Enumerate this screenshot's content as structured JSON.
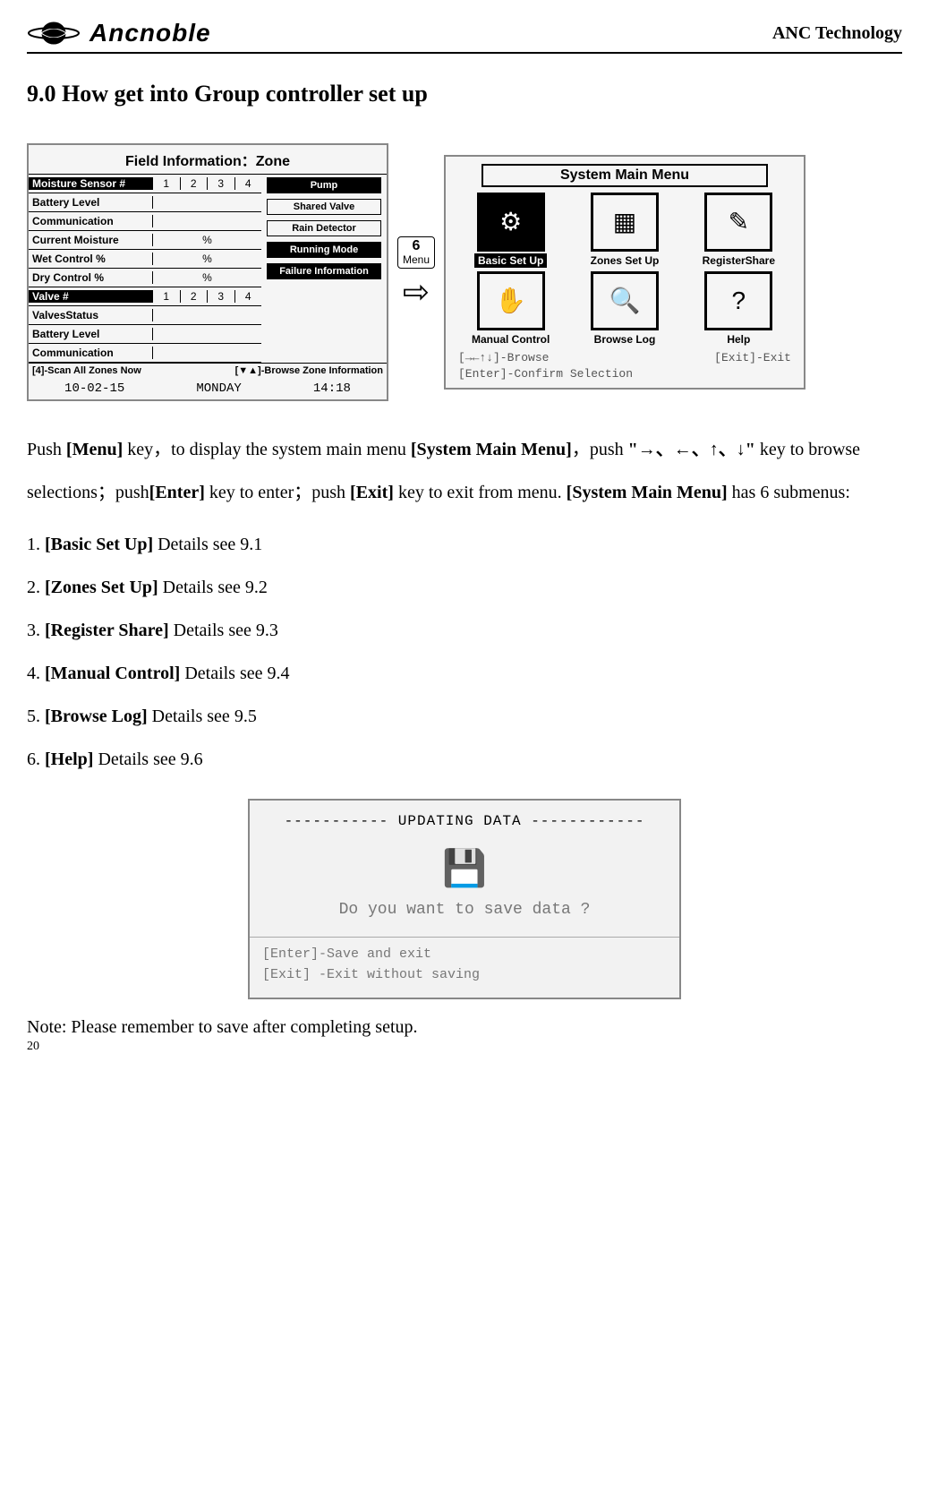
{
  "header": {
    "logo_text": "Ancnoble",
    "right_text": "ANC Technology"
  },
  "section_title": "9.0 How get into Group controller set up",
  "screen1": {
    "title": "Field Information：Zone",
    "rows_left": [
      {
        "label": "Moisture Sensor #",
        "cells": [
          "1",
          "2",
          "3",
          "4"
        ],
        "inv": true
      },
      {
        "label": "Battery Level"
      },
      {
        "label": "Communication"
      },
      {
        "label": "Current Moisture",
        "pct": "%"
      },
      {
        "label": "Wet Control %",
        "pct": "%"
      },
      {
        "label": "Dry Control %",
        "pct": "%"
      },
      {
        "label": "Valve  #",
        "cells": [
          "1",
          "2",
          "3",
          "4"
        ],
        "inv": true
      },
      {
        "label": "ValvesStatus"
      },
      {
        "label": "Battery Level"
      },
      {
        "label": "Communication"
      }
    ],
    "right_buttons": [
      {
        "t": "Pump",
        "inv": true
      },
      {
        "t": "Shared Valve",
        "inv": false
      },
      {
        "t": "Rain Detector",
        "inv": false
      },
      {
        "t": "Running Mode",
        "inv": true
      },
      {
        "t": "Failure Information",
        "inv": true
      }
    ],
    "foot_left": "[4]-Scan All Zones Now",
    "foot_right": "[▼▲]-Browse Zone Information",
    "status_date": "10-02-15",
    "status_day": "MONDAY",
    "status_time": "14:18"
  },
  "keycap": {
    "num": "6",
    "label": "Menu"
  },
  "arrow": "⇨",
  "screen2": {
    "title": "System Main Menu",
    "items": [
      {
        "cap": "Basic Set Up",
        "sel": true,
        "glyph": "⚙"
      },
      {
        "cap": "Zones Set Up",
        "sel": false,
        "glyph": "▦"
      },
      {
        "cap": "RegisterShare",
        "sel": false,
        "glyph": "✎"
      },
      {
        "cap": "Manual Control",
        "sel": false,
        "glyph": "✋"
      },
      {
        "cap": "Browse Log",
        "sel": false,
        "glyph": "🔍"
      },
      {
        "cap": "Help",
        "sel": false,
        "glyph": "?"
      }
    ],
    "hint_browse": "[→←↑↓]-Browse",
    "hint_exit": "[Exit]-Exit",
    "hint_enter": "[Enter]-Confirm Selection"
  },
  "para1_parts": {
    "p1": "Push ",
    "b1": "[Menu]",
    "p2": " key，to display the system main menu ",
    "b2": "[System Main Menu]",
    "p3": "，push ",
    "b3": "\"→、←、↑、↓\"",
    "p4": " key to browse selections；push",
    "b4": "[Enter]",
    "p5": " key to enter；push ",
    "b5": "[Exit]",
    "p6": " key to exit from menu. ",
    "b6": "[System Main Menu]",
    "p7": " has 6 submenus:"
  },
  "list": [
    {
      "n": "1. ",
      "b": "[Basic Set Up]",
      "t": " Details see 9.1"
    },
    {
      "n": "2. ",
      "b": "[Zones Set Up]",
      "t": " Details see 9.2"
    },
    {
      "n": "3. ",
      "b": "[Register Share]",
      "t": " Details see 9.3"
    },
    {
      "n": "4. ",
      "b": "[Manual Control]",
      "t": " Details see 9.4"
    },
    {
      "n": "5. ",
      "b": "[Browse Log]",
      "t": " Details see 9.5"
    },
    {
      "n": "6. ",
      "b": "[Help]",
      "t": " Details see 9.6"
    }
  ],
  "screen3": {
    "title": "----------- UPDATING DATA ------------",
    "question": "Do you want to save data ?",
    "hint1": "[Enter]-Save and exit",
    "hint2": "[Exit] -Exit without saving"
  },
  "note": "Note:   Please remember to save after completing setup.",
  "page_num": "20"
}
